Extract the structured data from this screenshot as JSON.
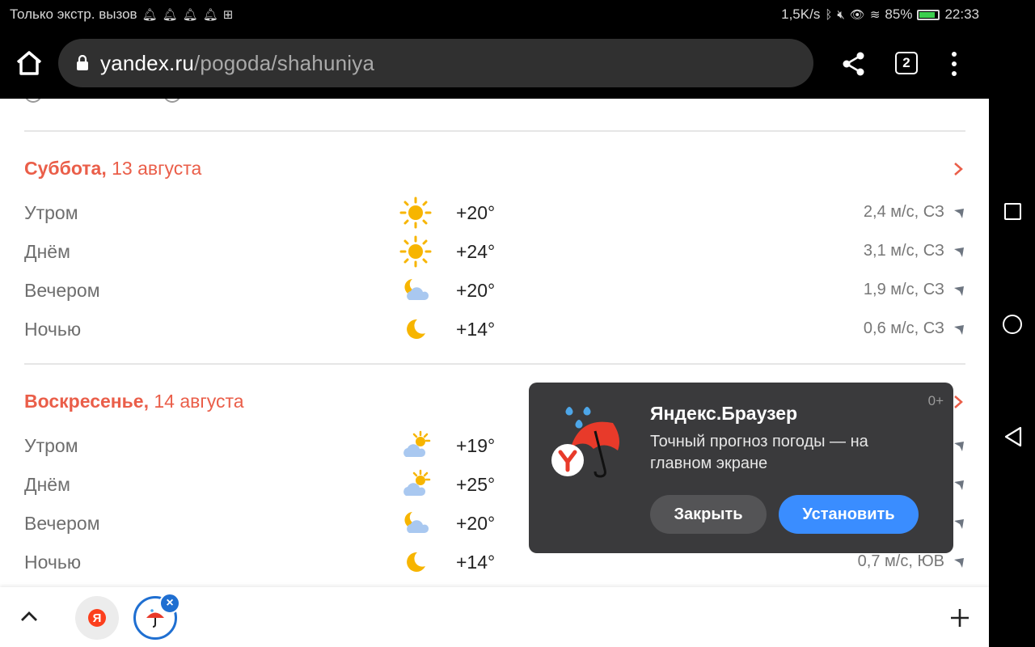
{
  "status_bar": {
    "carrier": "Только экстр. вызов",
    "net_speed": "1,5K/s",
    "battery": "85%",
    "time": "22:33"
  },
  "browser": {
    "url_domain": "yandex.ru",
    "url_path": "/pogoda/shahuniya",
    "tab_count": "2"
  },
  "days": [
    {
      "weekday": "Суббота,",
      "date": "13 августа",
      "rows": [
        {
          "part": "Утром",
          "icon": "sun-icon",
          "temp": "+20°",
          "wind": "2,4 м/с, СЗ"
        },
        {
          "part": "Днём",
          "icon": "sun-icon",
          "temp": "+24°",
          "wind": "3,1 м/с, СЗ"
        },
        {
          "part": "Вечером",
          "icon": "moon-cloud-icon",
          "temp": "+20°",
          "wind": "1,9 м/с, СЗ"
        },
        {
          "part": "Ночью",
          "icon": "moon-icon",
          "temp": "+14°",
          "wind": "0,6 м/с, СЗ"
        }
      ]
    },
    {
      "weekday": "Воскресенье,",
      "date": "14 августа",
      "rows": [
        {
          "part": "Утром",
          "icon": "sun-cloud-icon",
          "temp": "+19°",
          "wind": ""
        },
        {
          "part": "Днём",
          "icon": "sun-cloud-icon",
          "temp": "+25°",
          "wind": ""
        },
        {
          "part": "Вечером",
          "icon": "moon-cloud-icon",
          "temp": "+20°",
          "wind": ""
        },
        {
          "part": "Ночью",
          "icon": "moon-icon",
          "temp": "+14°",
          "wind": "0,7 м/с, ЮВ"
        }
      ]
    }
  ],
  "popup": {
    "age_rating": "0+",
    "title": "Яндекс.Браузер",
    "description": "Точный прогноз погоды — на главном экране",
    "close_label": "Закрыть",
    "install_label": "Установить"
  },
  "bottom_tabs": {
    "ya_letter": "Я"
  },
  "colors": {
    "accent_red": "#ea5e49",
    "install_blue": "#3a8dff",
    "popup_bg": "#3a3a3c"
  }
}
